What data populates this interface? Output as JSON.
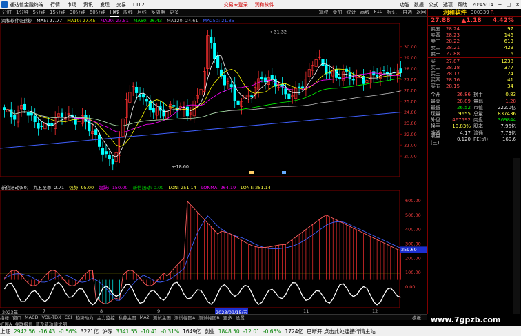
{
  "menubar": {
    "app": "通达信金融终端",
    "items": [
      "行情",
      "市场",
      "资讯",
      "发现",
      "交易",
      "L1L2"
    ],
    "hot": "交易未登录",
    "stock_link": "润和软件",
    "right": [
      "功能",
      "数据",
      "公式",
      "选项",
      "帮助"
    ],
    "time": "20:45:14"
  },
  "toolbar": {
    "periods": [
      "分时",
      "1分钟",
      "5分钟",
      "15分钟",
      "30分钟",
      "60分钟",
      "日线",
      "周线",
      "月线",
      "多周期",
      "更多"
    ],
    "active": "日线",
    "right": [
      "复权",
      "叠加",
      "统计",
      "画线",
      "F10",
      "标记",
      "-自选",
      "返回"
    ]
  },
  "ma_legend": {
    "title": "润和软件(日线)",
    "ma5": "MA5: 27.77",
    "ma10": "MA10: 27.45",
    "ma20": "MA20: 27.51",
    "ma60": "MA60: 26.43",
    "ma120": "MA120: 24.61",
    "ma250": "MA250: 21.85"
  },
  "price_axis": [
    "30.00",
    "29.00",
    "28.00",
    "27.00",
    "26.00",
    "25.00",
    "24.00",
    "23.00",
    "22.00",
    "21.00",
    "20.00"
  ],
  "high_label": "31.32",
  "low_label": "18.60",
  "ind_legend": {
    "name": "新信涵动(50)",
    "a": "九五至尊: 2.71",
    "b": "强势: 95.00",
    "c": "超跌: -150.00",
    "d": "新信涵动: 0.00",
    "e": "LON: 251.14",
    "f": "LONMA: 264.19",
    "g": "LONT: 251.14"
  },
  "ind_axis": [
    "600.00",
    "500.00",
    "400.00",
    "300.00",
    "200.00",
    "100.00",
    "0.00"
  ],
  "ind_tag": "259.69",
  "dates": {
    "d0": "2023年",
    "d1": "7",
    "d2": "8",
    "d3": "9",
    "d4": "2023/09/15/五",
    "d5": "11",
    "d6": "12"
  },
  "quote": {
    "name": "润和软件",
    "code": "300339",
    "r": "R",
    "price": "27.88",
    "change": "▲1.18",
    "pct": "4.42%"
  },
  "asks": [
    {
      "label": "卖五",
      "price": "28.24",
      "vol": "97"
    },
    {
      "label": "卖四",
      "price": "28.23",
      "vol": "146"
    },
    {
      "label": "卖三",
      "price": "28.22",
      "vol": "613"
    },
    {
      "label": "卖二",
      "price": "28.21",
      "vol": "429"
    },
    {
      "label": "卖一",
      "price": "27.88",
      "vol": "6"
    }
  ],
  "bids": [
    {
      "label": "买一",
      "price": "27.87",
      "vol": "1238"
    },
    {
      "label": "买二",
      "price": "28.18",
      "vol": "377"
    },
    {
      "label": "买三",
      "price": "28.17",
      "vol": "24"
    },
    {
      "label": "买四",
      "price": "28.16",
      "vol": "41"
    },
    {
      "label": "买五",
      "price": "28.15",
      "vol": "34"
    }
  ],
  "stats": [
    [
      "今开",
      "26.86",
      "换手",
      "0.83"
    ],
    [
      "最高",
      "28.89",
      "量比",
      "1.28"
    ],
    [
      "最低",
      "26.52",
      "市值",
      "222.0亿"
    ],
    [
      "现量",
      "9655",
      "总量",
      "837436"
    ],
    [
      "外盘",
      "467592",
      "内盘",
      "369844"
    ],
    [
      "换手",
      "10.83%",
      "股本",
      "7.96亿"
    ],
    [
      "净资",
      "4.17",
      "流通",
      "7.73亿"
    ],
    [
      "收益(三)",
      "0.120",
      "PE(动)",
      "169.6"
    ]
  ],
  "btabs": [
    "指标",
    "窗口",
    "MACD",
    "VOL-TDX",
    "CCI",
    "趋势动力",
    "主力监控",
    "私募主图",
    "MA2",
    "测试主图",
    "测试幅图A",
    "测试幅图B",
    "更多",
    "设置"
  ],
  "btabs2": [
    "扩展A",
    "关联报价",
    "普及新功能说明"
  ],
  "tab_right": "模板",
  "status": [
    {
      "t": "上证",
      "c": ""
    },
    {
      "t": "2942.56",
      "c": "g"
    },
    {
      "t": "-16.43",
      "c": "g"
    },
    {
      "t": "-0.56%",
      "c": "g"
    },
    {
      "t": "3221亿",
      "c": ""
    },
    {
      "t": "沪深",
      "c": ""
    },
    {
      "t": "3341.55",
      "c": "g"
    },
    {
      "t": "-10.41",
      "c": "g"
    },
    {
      "t": "-0.31%",
      "c": "g"
    },
    {
      "t": "1649亿",
      "c": ""
    },
    {
      "t": "创业",
      "c": ""
    },
    {
      "t": "1848.50",
      "c": "g"
    },
    {
      "t": "-12.01",
      "c": "g"
    },
    {
      "t": "-0.65%",
      "c": "g"
    },
    {
      "t": "1724亿",
      "c": ""
    },
    {
      "t": "已断开.点击此处连接行情主站",
      "c": ""
    }
  ],
  "watermark": "www.7gpzb.com",
  "colors": {
    "up": "#ff3030",
    "down": "#00ffff",
    "ma5": "#ffffff",
    "ma10": "#ffff00",
    "ma20": "#ff00ff",
    "ma60": "#00ff00",
    "ma120": "#c0c0c0",
    "ma250": "#4060ff"
  },
  "chart_data": {
    "type": "candlestick",
    "series": [
      "MA5",
      "MA10",
      "MA20",
      "MA60",
      "MA120",
      "MA250"
    ],
    "ylim": [
      19.5,
      30.8
    ],
    "high": 31.32,
    "low": 18.6
  }
}
